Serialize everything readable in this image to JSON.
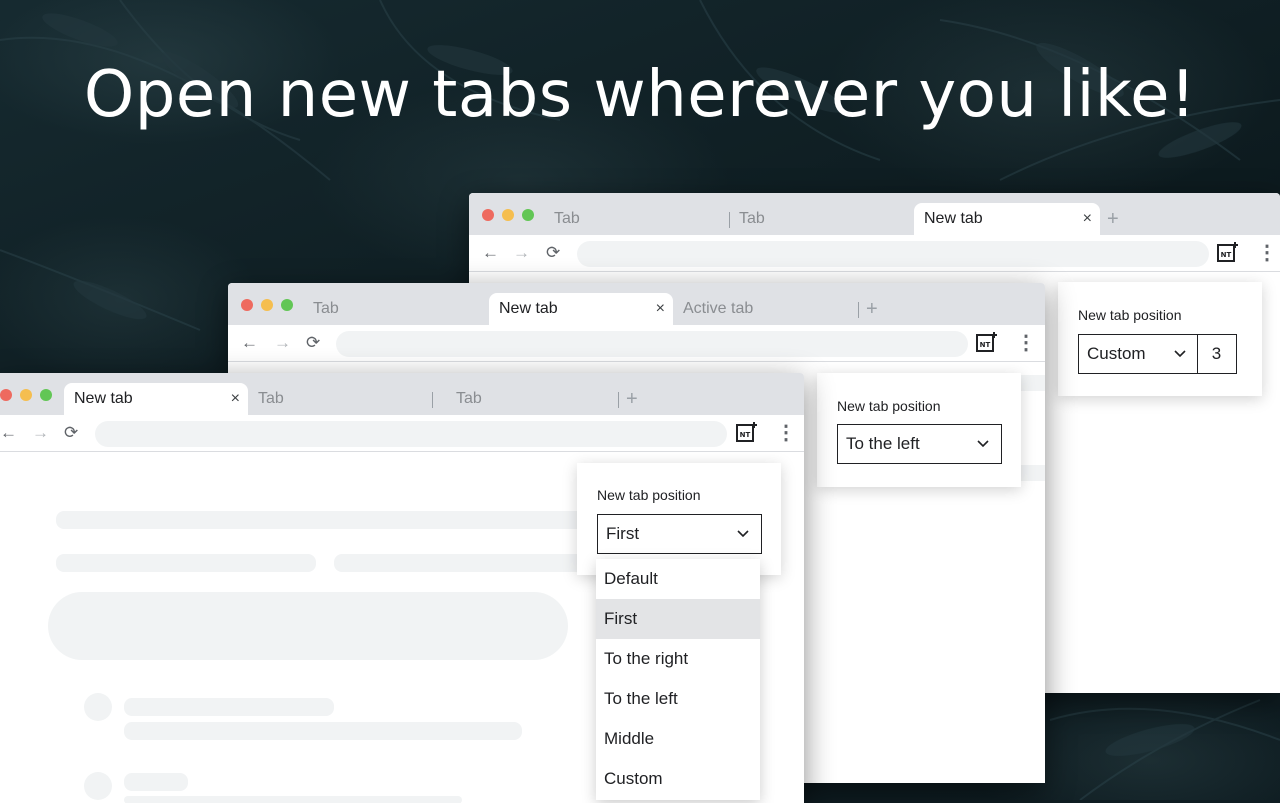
{
  "headline": "Open new tabs wherever you like!",
  "colors": {
    "bg": "#0f1d22",
    "tabbar": "#dfe1e5",
    "traffic_red": "#ee6a5f",
    "traffic_yellow": "#f5be4f",
    "traffic_green": "#62c655"
  },
  "icons": [
    "back-arrow-icon",
    "forward-arrow-icon",
    "reload-icon",
    "new-tab-extension-icon",
    "more-vert-icon",
    "close-icon",
    "new-tab-plus-icon",
    "chevron-down-icon"
  ],
  "window_back": {
    "tabs": [
      "Tab",
      "Tab",
      "New tab"
    ],
    "active_tab": "New tab",
    "popup": {
      "label": "New tab position",
      "selected": "Custom",
      "custom_value": "3"
    }
  },
  "window_middle": {
    "tabs": [
      "Tab",
      "New tab",
      "Active tab"
    ],
    "active_tab": "New tab",
    "popup": {
      "label": "New tab position",
      "selected": "To the left"
    }
  },
  "window_front": {
    "tabs": [
      "New tab",
      "Tab",
      "Tab"
    ],
    "active_tab": "New tab",
    "popup": {
      "label": "New tab position",
      "selected": "First"
    },
    "options": [
      "Default",
      "First",
      "To the right",
      "To the left",
      "Middle",
      "Custom"
    ]
  },
  "glyphs": {
    "close": "×",
    "plus": "+",
    "back": "←",
    "forward": "→",
    "reload": "⟳",
    "more": "⋮",
    "ext": "NT"
  }
}
